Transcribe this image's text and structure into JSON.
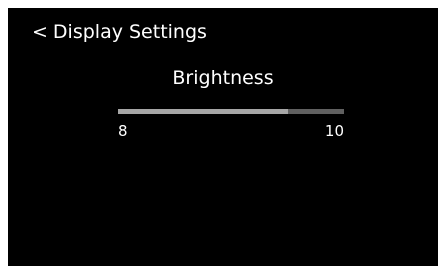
{
  "header": {
    "back_icon": "<",
    "title": "Display Settings"
  },
  "setting": {
    "title": "Brightness",
    "slider": {
      "value_fraction": 0.75,
      "min_label": "8",
      "max_label": "10"
    }
  },
  "colors": {
    "background": "#000000",
    "text": "#ffffff",
    "track": "#606060",
    "fill": "#a6a6a6"
  }
}
